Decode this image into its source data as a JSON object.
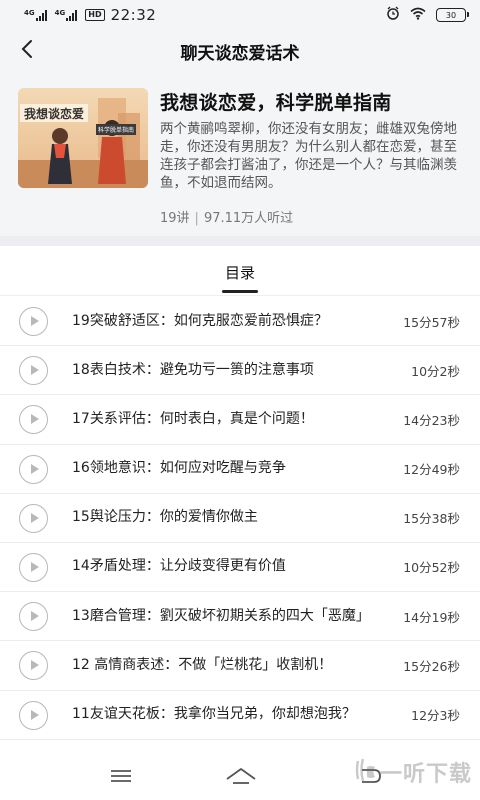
{
  "status_bar": {
    "network_1": "4G",
    "network_2": "4G",
    "hd_badge": "HD",
    "time": "22:32",
    "battery": "30"
  },
  "header": {
    "title": "聊天谈恋爱话术"
  },
  "course": {
    "cover_text": "我想谈恋爱",
    "cover_subtext": "科学脱单指南",
    "title": "我想谈恋爱，科学脱单指南",
    "description": "两个黄鹂鸣翠柳，你还没有女朋友；雌雄双兔傍地走，你还没有男朋友？为什么别人都在恋爱，甚至连孩子都会打酱油了，你还是一个人？与其临渊羡鱼，不如退而结网。",
    "lessons": "19讲",
    "listeners": "97.11万人听过"
  },
  "tabs": {
    "toc": "目录"
  },
  "episodes": [
    {
      "title": "19突破舒适区：如何克服恋爱前恐惧症？",
      "duration": "15分57秒"
    },
    {
      "title": "18表白技术：避免功亏一篑的注意事项",
      "duration": "10分2秒"
    },
    {
      "title": "17关系评估：何时表白，真是个问题！",
      "duration": "14分23秒"
    },
    {
      "title": "16领地意识：如何应对吃醒与竞争",
      "duration": "12分49秒"
    },
    {
      "title": "15舆论压力：你的爱情你做主",
      "duration": "15分38秒"
    },
    {
      "title": "14矛盾处理：让分歧变得更有价值",
      "duration": "10分52秒"
    },
    {
      "title": "13磨合管理：劉灭破坏初期关系的四大「恶魔」",
      "duration": "14分19秒"
    },
    {
      "title": "12 高情商表述：不做「烂桃花」收割机！",
      "duration": "15分26秒"
    },
    {
      "title": "11友谊天花板：我拿你当兄弟，你却想泡我？",
      "duration": "12分3秒"
    }
  ],
  "watermark": {
    "text": "一听下载"
  },
  "colors": {
    "header_bg": "#f4f5f7",
    "divider": "#ececec",
    "play_icon": "#b8b8b8"
  }
}
